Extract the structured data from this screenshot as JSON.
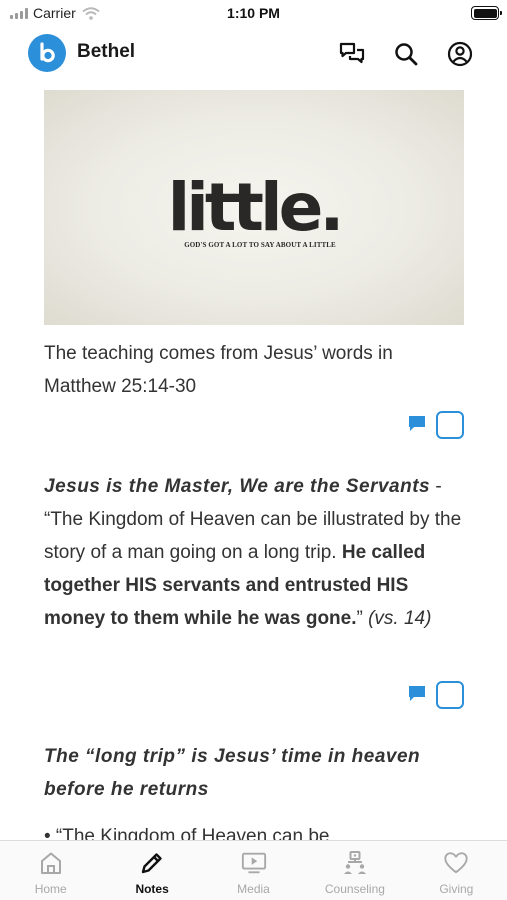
{
  "status_bar": {
    "carrier": "Carrier",
    "time": "1:10 PM"
  },
  "header": {
    "app_name": "Bethel",
    "icons": [
      "chat-icon",
      "search-icon",
      "account-icon"
    ]
  },
  "hero": {
    "title": "little.",
    "subtitle": "GOD'S GOT A LOT TO SAY ABOUT A LITTLE"
  },
  "notes": {
    "p1_text": "The teaching comes from Jesus’ words in Matthew 25:14-30",
    "p2_emphasis": "Jesus is the Master, We are the Servants",
    "p2_text": " - “The Kingdom of Heaven can be illustrated by the story of a man going on a long trip. ",
    "p2_bold": "He called together HIS servants and entrusted HIS money to them while he was gone.",
    "p2_close": "” ",
    "p2_ref": "(vs. 14)",
    "heading": "The “long trip” is Jesus’ time in heaven before he returns",
    "p3_text": "• “The Kingdom of Heaven can be"
  },
  "tabs": [
    {
      "label": "Home",
      "icon": "home-icon",
      "active": false
    },
    {
      "label": "Notes",
      "icon": "pencil-icon",
      "active": true
    },
    {
      "label": "Media",
      "icon": "media-icon",
      "active": false
    },
    {
      "label": "Counseling",
      "icon": "counseling-icon",
      "active": false
    },
    {
      "label": "Giving",
      "icon": "heart-icon",
      "active": false
    }
  ],
  "colors": {
    "accent": "#2b8fd9",
    "inactive_tab": "#a8a8a8",
    "text": "#333333"
  }
}
